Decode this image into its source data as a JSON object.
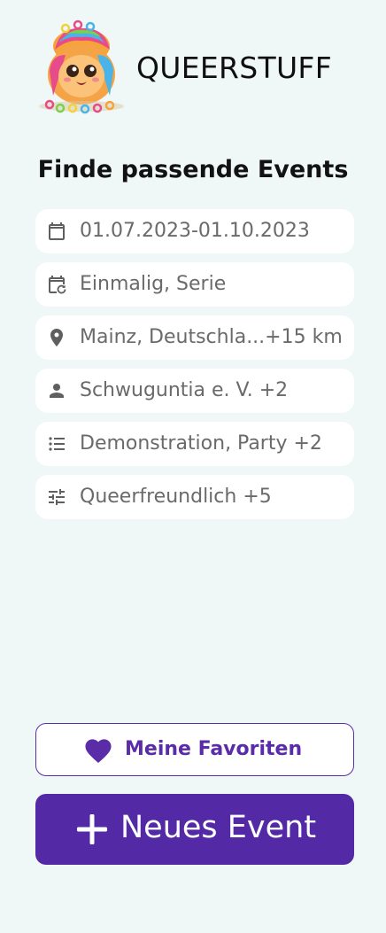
{
  "header": {
    "app_title": "QUEERSTUFF",
    "logo": "rainbow-mascot-logo"
  },
  "section_title": "Finde passende Events",
  "filters": [
    {
      "icon": "calendar-icon",
      "value": "01.07.2023-01.10.2023"
    },
    {
      "icon": "calendar-repeat-icon",
      "value": "Einmalig, Serie"
    },
    {
      "icon": "location-pin-icon",
      "value": "Mainz, Deutschla...+15 km"
    },
    {
      "icon": "person-icon",
      "value": "Schwuguntia e. V. +2"
    },
    {
      "icon": "list-icon",
      "value": "Demonstration, Party +2"
    },
    {
      "icon": "sliders-icon",
      "value": "Queerfreundlich +5"
    }
  ],
  "favorites_button": {
    "label": "Meine Favoriten",
    "icon": "heart-icon"
  },
  "new_event_button": {
    "label": "Neues Event",
    "icon": "plus-icon"
  },
  "colors": {
    "background": "#eff8f7",
    "accent": "#5329a6",
    "text_muted": "#6a6a6a"
  }
}
